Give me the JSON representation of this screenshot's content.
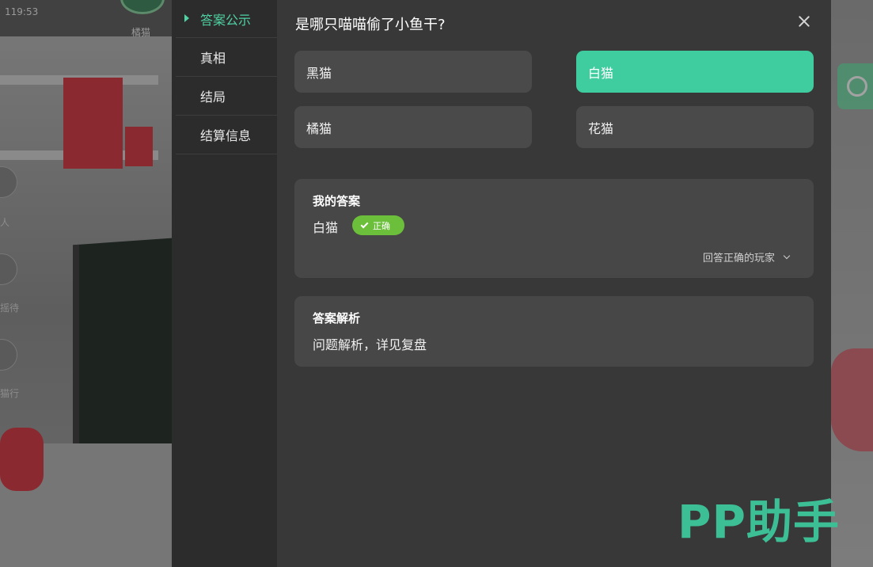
{
  "status": {
    "time": "119:53"
  },
  "background": {
    "player_name": "橘猫",
    "side_labels": [
      "人",
      "摇待",
      "猫行"
    ]
  },
  "sidenav": {
    "items": [
      {
        "label": "答案公示",
        "active": true
      },
      {
        "label": "真相",
        "active": false
      },
      {
        "label": "结局",
        "active": false
      },
      {
        "label": "结算信息",
        "active": false
      }
    ]
  },
  "question": {
    "title": "是哪只喵喵偷了小鱼干?",
    "options": [
      {
        "label": "黑猫",
        "selected": false
      },
      {
        "label": "白猫",
        "selected": true
      },
      {
        "label": "橘猫",
        "selected": false
      },
      {
        "label": "花猫",
        "selected": false
      }
    ]
  },
  "my_answer": {
    "title": "我的答案",
    "value": "白猫",
    "badge": "正确",
    "correct_players_label": "回答正确的玩家"
  },
  "analysis": {
    "title": "答案解析",
    "text": "问题解析，详见复盘"
  },
  "watermark": "PP助手",
  "colors": {
    "accent": "#3fcc9f",
    "badge": "#6bbf3a",
    "panel": "#383838",
    "card": "#474747",
    "nav": "#2c2c2c"
  }
}
